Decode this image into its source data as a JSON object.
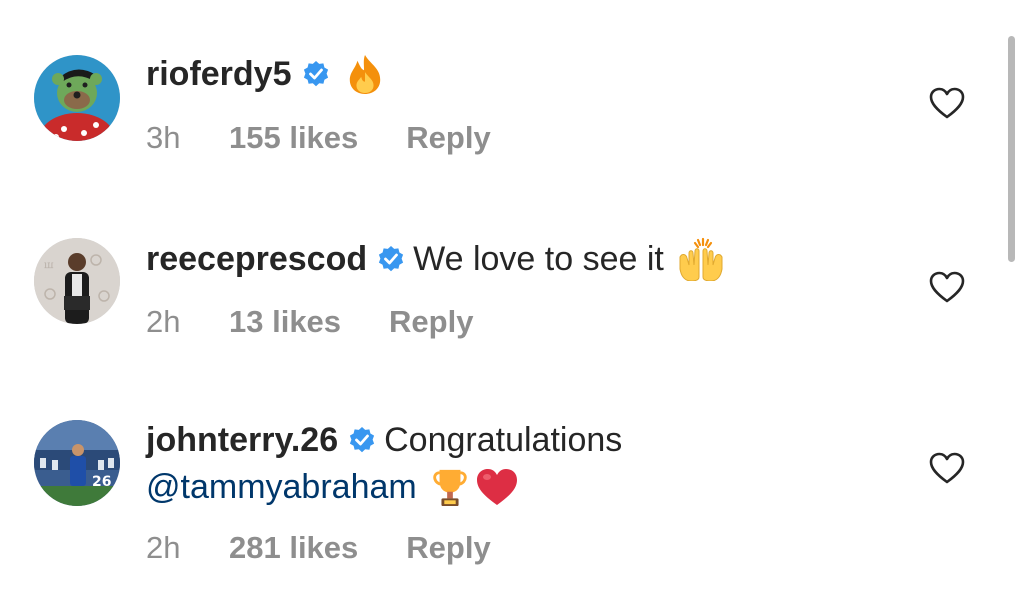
{
  "comments": [
    {
      "username": "rioferdy5",
      "text": "",
      "mention": "",
      "emojis": [
        "fire"
      ],
      "time": "3h",
      "likes": "155 likes",
      "reply": "Reply"
    },
    {
      "username": "reeceprescod",
      "text": "We love to see it",
      "mention": "",
      "emojis": [
        "raising-hands"
      ],
      "time": "2h",
      "likes": "13 likes",
      "reply": "Reply"
    },
    {
      "username": "johnterry.26",
      "text": "Congratulations",
      "mention": "@tammyabraham",
      "emojis": [
        "trophy",
        "red-heart"
      ],
      "time": "2h",
      "likes": "281 likes",
      "reply": "Reply"
    }
  ],
  "colors": {
    "text": "#262626",
    "meta": "#8e8e8e",
    "mention": "#00376b",
    "verified": "#3897f0"
  },
  "icons": {
    "verified": "verified-badge-icon",
    "like": "heart-outline-icon"
  }
}
